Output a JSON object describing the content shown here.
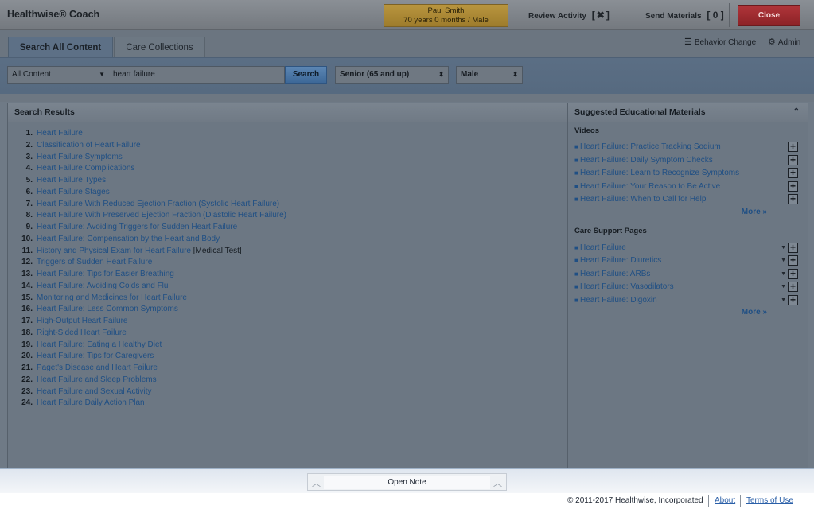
{
  "app": {
    "title": "Healthwise® Coach"
  },
  "patient": {
    "name": "Paul Smith",
    "details": "70 years 0 months / Male"
  },
  "header": {
    "review_label": "Review Activity",
    "review_bracket_open": "[",
    "review_x": "✖",
    "review_bracket_close": "]",
    "send_label": "Send Materials",
    "send_count": "[ 0 ]",
    "close_label": "Close"
  },
  "tabs": [
    {
      "label": "Search All Content",
      "active": true
    },
    {
      "label": "Care Collections",
      "active": false
    }
  ],
  "toplinks": {
    "behavior": "Behavior Change",
    "admin": "Admin"
  },
  "search": {
    "content_filter": "All Content",
    "query": "heart failure",
    "button": "Search",
    "age_filter": "Senior (65 and up)",
    "gender_filter": "Male"
  },
  "results": {
    "heading": "Search Results",
    "items": [
      {
        "num": "1.",
        "title": "Heart Failure",
        "tag": ""
      },
      {
        "num": "2.",
        "title": "Classification of Heart Failure",
        "tag": ""
      },
      {
        "num": "3.",
        "title": "Heart Failure Symptoms",
        "tag": ""
      },
      {
        "num": "4.",
        "title": "Heart Failure Complications",
        "tag": ""
      },
      {
        "num": "5.",
        "title": "Heart Failure Types",
        "tag": ""
      },
      {
        "num": "6.",
        "title": "Heart Failure Stages",
        "tag": ""
      },
      {
        "num": "7.",
        "title": "Heart Failure With Reduced Ejection Fraction (Systolic Heart Failure)",
        "tag": ""
      },
      {
        "num": "8.",
        "title": "Heart Failure With Preserved Ejection Fraction (Diastolic Heart Failure)",
        "tag": ""
      },
      {
        "num": "9.",
        "title": "Heart Failure: Avoiding Triggers for Sudden Heart Failure",
        "tag": ""
      },
      {
        "num": "10.",
        "title": "Heart Failure: Compensation by the Heart and Body",
        "tag": ""
      },
      {
        "num": "11.",
        "title": "History and Physical Exam for Heart Failure",
        "tag": "[Medical Test]"
      },
      {
        "num": "12.",
        "title": "Triggers of Sudden Heart Failure",
        "tag": ""
      },
      {
        "num": "13.",
        "title": "Heart Failure: Tips for Easier Breathing",
        "tag": ""
      },
      {
        "num": "14.",
        "title": "Heart Failure: Avoiding Colds and Flu",
        "tag": ""
      },
      {
        "num": "15.",
        "title": "Monitoring and Medicines for Heart Failure",
        "tag": ""
      },
      {
        "num": "16.",
        "title": "Heart Failure: Less Common Symptoms",
        "tag": ""
      },
      {
        "num": "17.",
        "title": "High-Output Heart Failure",
        "tag": ""
      },
      {
        "num": "18.",
        "title": "Right-Sided Heart Failure",
        "tag": ""
      },
      {
        "num": "19.",
        "title": "Heart Failure: Eating a Healthy Diet",
        "tag": ""
      },
      {
        "num": "20.",
        "title": "Heart Failure: Tips for Caregivers",
        "tag": ""
      },
      {
        "num": "21.",
        "title": "Paget's Disease and Heart Failure",
        "tag": ""
      },
      {
        "num": "22.",
        "title": "Heart Failure and Sleep Problems",
        "tag": ""
      },
      {
        "num": "23.",
        "title": "Heart Failure and Sexual Activity",
        "tag": ""
      },
      {
        "num": "24.",
        "title": "Heart Failure Daily Action Plan",
        "tag": ""
      }
    ]
  },
  "suggested": {
    "heading": "Suggested Educational Materials",
    "videos": {
      "title": "Videos",
      "items": [
        "Heart Failure: Practice Tracking Sodium",
        "Heart Failure: Daily Symptom Checks",
        "Heart Failure: Learn to Recognize Symptoms",
        "Heart Failure: Your Reason to Be Active",
        "Heart Failure: When to Call for Help"
      ],
      "more": "More »"
    },
    "care": {
      "title": "Care Support Pages",
      "items": [
        "Heart Failure",
        "Heart Failure: Diuretics",
        "Heart Failure: ARBs",
        "Heart Failure: Vasodilators",
        "Heart Failure: Digoxin"
      ],
      "more": "More »"
    }
  },
  "note": {
    "label": "Open Note"
  },
  "footer": {
    "copyright": "© 2011-2017 Healthwise, Incorporated",
    "about": "About",
    "terms": "Terms of Use"
  }
}
